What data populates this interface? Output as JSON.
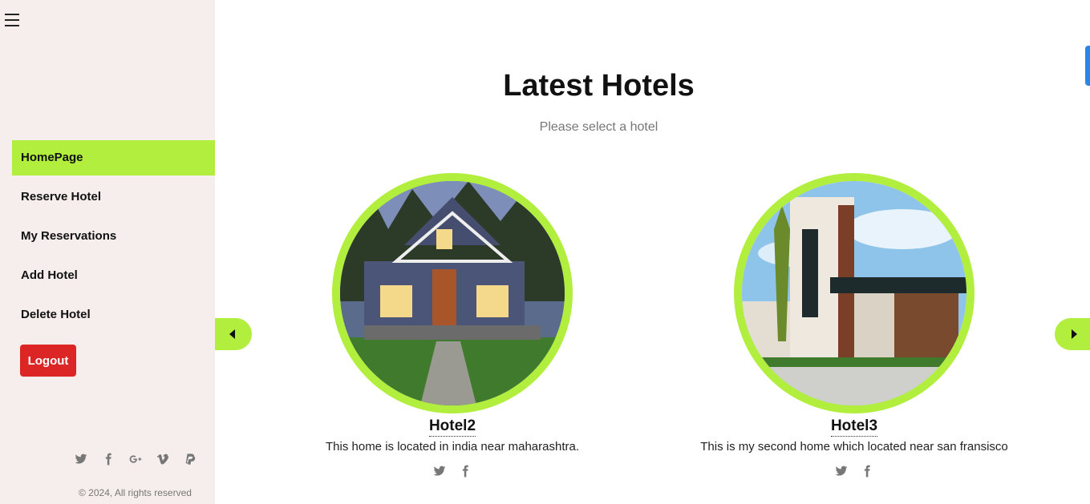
{
  "sidebar": {
    "menu_icon": "hamburger-icon",
    "items": [
      {
        "label": "HomePage",
        "active": true
      },
      {
        "label": "Reserve Hotel",
        "active": false
      },
      {
        "label": "My Reservations",
        "active": false
      },
      {
        "label": "Add Hotel",
        "active": false
      },
      {
        "label": "Delete Hotel",
        "active": false
      }
    ],
    "logout_label": "Logout",
    "social_icons": [
      "twitter-icon",
      "facebook-icon",
      "google-plus-icon",
      "vimeo-icon",
      "paypal-icon"
    ],
    "copyright": "© 2024, All rights reserved"
  },
  "main": {
    "title": "Latest Hotels",
    "subtitle": "Please select a hotel",
    "hotels": [
      {
        "name": "Hotel2",
        "description": "This home is located in india near maharashtra.",
        "social_icons": [
          "twitter-icon",
          "facebook-icon"
        ]
      },
      {
        "name": "Hotel3",
        "description": "This is my second home which located near san fransisco",
        "social_icons": [
          "twitter-icon",
          "facebook-icon"
        ]
      }
    ],
    "prev_icon": "caret-left-icon",
    "next_icon": "caret-right-icon"
  },
  "colors": {
    "accent": "#b2ee3e",
    "sidebar_bg": "#f6eeec",
    "logout": "#dc2626"
  }
}
